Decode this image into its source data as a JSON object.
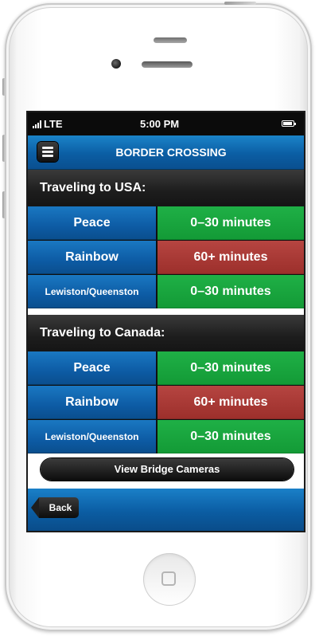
{
  "status_bar": {
    "carrier": "LTE",
    "time": "5:00 PM"
  },
  "nav": {
    "title": "BORDER CROSSING",
    "menu_icon": "hamburger-menu-icon"
  },
  "sections": [
    {
      "title": "Traveling to USA:",
      "rows": [
        {
          "bridge": "Peace",
          "wait": "0–30 minutes",
          "status": "green"
        },
        {
          "bridge": "Rainbow",
          "wait": "60+ minutes",
          "status": "red"
        },
        {
          "bridge": "Lewiston/Queenston",
          "wait": "0–30 minutes",
          "status": "green"
        }
      ]
    },
    {
      "title": "Traveling to Canada:",
      "rows": [
        {
          "bridge": "Peace",
          "wait": "0–30 minutes",
          "status": "green"
        },
        {
          "bridge": "Rainbow",
          "wait": "60+ minutes",
          "status": "red"
        },
        {
          "bridge": "Lewiston/Queenston",
          "wait": "0–30 minutes",
          "status": "green"
        }
      ]
    }
  ],
  "actions": {
    "view_cameras": "View Bridge Cameras",
    "back": "Back"
  },
  "colors": {
    "green": "#17a23d",
    "red": "#a8393b",
    "blue": "#0d5ba4"
  }
}
